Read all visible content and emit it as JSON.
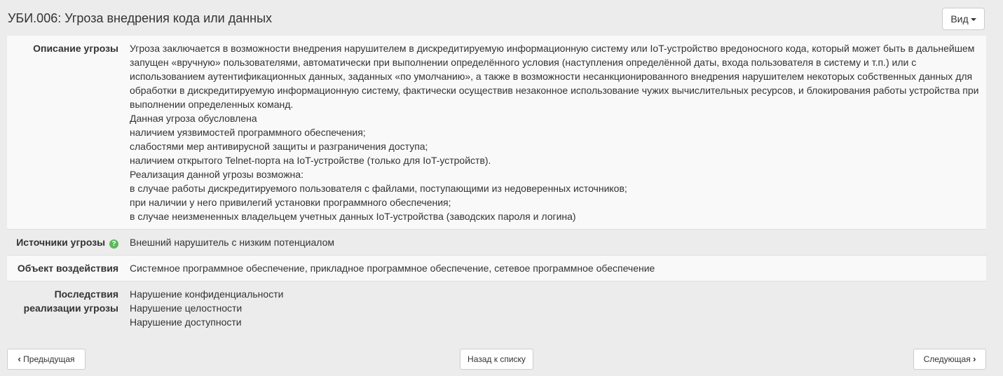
{
  "page": {
    "title": "УБИ.006: Угроза внедрения кода или данных",
    "view_button_label": "Вид"
  },
  "details": {
    "description": {
      "label": "Описание угрозы",
      "lines": [
        "Угроза заключается в возможности внедрения нарушителем в дискредитируемую информационную систему или IoT-устройство вредоносного кода, который может быть в дальнейшем запущен «вручную» пользователями, автоматически при выполнении определённого условия (наступления определённой даты, входа пользователя в систему и т.п.) или с использованием аутентификационных данных, заданных «по умолчанию», а также в возможности несанкционированного внедрения нарушителем некоторых собственных данных для обработки в дискредитируемую информационную систему, фактически осуществив незаконное использование чужих вычислительных ресурсов, и блокирования работы устройства при выполнении определенных команд.",
        "Данная угроза обусловлена",
        "наличием уязвимостей программного обеспечения;",
        "слабостями мер антивирусной защиты и разграничения доступа;",
        "наличием открытого Telnet-порта на IoT-устройстве (только для IoT-устройств).",
        "Реализация данной угрозы возможна:",
        "в случае работы дискредитируемого пользователя с файлами, поступающими из недоверенных источников;",
        "при наличии у него привилегий установки программного обеспечения;",
        "в случае неизмененных владельцем учетных данных IoT-устройства (заводских пароля и логина)"
      ]
    },
    "sources": {
      "label": "Источники угрозы",
      "help_icon": "?",
      "value": "Внешний нарушитель с низким потенциалом"
    },
    "target": {
      "label": "Объект воздействия",
      "value": "Системное программное обеспечение, прикладное программное обеспечение, сетевое программное обеспечение"
    },
    "consequences": {
      "label": "Последствия реализации угрозы",
      "lines": [
        "Нарушение конфиденциальности",
        "Нарушение целостности",
        "Нарушение доступности"
      ]
    }
  },
  "navigation": {
    "prev_label": "Предыдущая",
    "prev_icon": "‹",
    "back_label": "Назад к списку",
    "next_label": "Следующая",
    "next_icon": "›"
  },
  "colors": {
    "page_background": "#ececec",
    "striped_row": "#f9f9f9",
    "help_icon": "#5cb85c"
  }
}
